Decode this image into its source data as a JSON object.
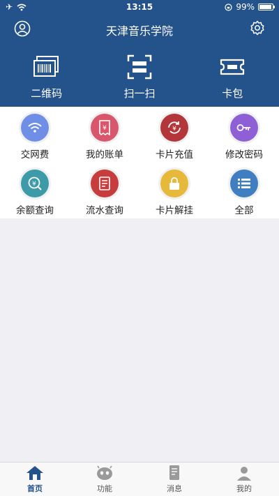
{
  "status": {
    "time": "13:15",
    "battery": "99%"
  },
  "header": {
    "title": "天津音乐学院",
    "actions": [
      {
        "label": "二维码",
        "icon": "barcode-icon"
      },
      {
        "label": "扫一扫",
        "icon": "scan-icon"
      },
      {
        "label": "卡包",
        "icon": "ticket-icon"
      }
    ]
  },
  "functions": [
    {
      "label": "交网费",
      "icon": "wifi-icon",
      "color": "#6f8fe6"
    },
    {
      "label": "我的账单",
      "icon": "bill-icon",
      "color": "#d9576d"
    },
    {
      "label": "卡片充值",
      "icon": "recharge-icon",
      "color": "#b3363b"
    },
    {
      "label": "修改密码",
      "icon": "key-icon",
      "color": "#8f5fd6"
    },
    {
      "label": "余额查询",
      "icon": "balance-icon",
      "color": "#3d9aa8"
    },
    {
      "label": "流水查询",
      "icon": "flow-icon",
      "color": "#c73d3d"
    },
    {
      "label": "卡片解挂",
      "icon": "lock-icon",
      "color": "#e7b93a"
    },
    {
      "label": "全部",
      "icon": "list-icon",
      "color": "#3f7fc1"
    }
  ],
  "tabs": [
    {
      "label": "首页",
      "icon": "home-icon"
    },
    {
      "label": "功能",
      "icon": "robot-icon"
    },
    {
      "label": "消息",
      "icon": "message-icon"
    },
    {
      "label": "我的",
      "icon": "user-icon"
    }
  ]
}
